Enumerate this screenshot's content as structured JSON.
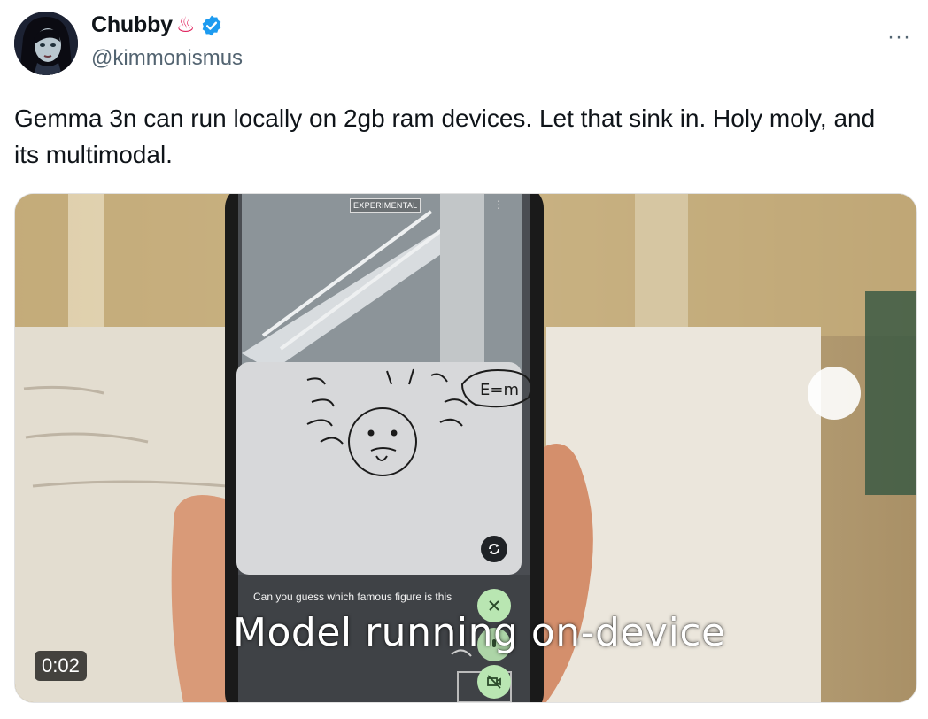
{
  "author": {
    "display_name": "Chubby",
    "emoji": "♨",
    "handle": "@kimmonismus",
    "verified": true
  },
  "more_menu_label": "···",
  "tweet_text": "Gemma 3n can run locally on 2gb ram devices. Let that sink in. Holy moly, and its multimodal.",
  "media": {
    "phone_badge": "EXPERIMENTAL",
    "phone_prompt": "Can you guess which famous figure is this",
    "subtitle": "Model running on-device",
    "timestamp": "0:02",
    "icons": [
      "switch-camera-icon",
      "close-icon",
      "camera-off-icon"
    ]
  },
  "colors": {
    "verified_blue": "#1d9bf0",
    "secondary_text": "#536471",
    "primary_text": "#0f1419"
  }
}
